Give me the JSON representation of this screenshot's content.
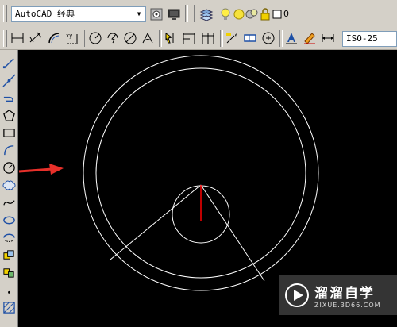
{
  "toolbar_top": {
    "workspace_combo": {
      "value": "AutoCAD 经典"
    },
    "layer_combo": {
      "value": "0"
    }
  },
  "toolbar_dim": {
    "dimstyle_combo": {
      "value": "ISO-25"
    }
  },
  "left_toolbar": {
    "items": [
      "line-icon",
      "construction-line-icon",
      "polyline-icon",
      "polygon-icon",
      "rectangle-icon",
      "arc-icon",
      "circle-icon",
      "revision-cloud-icon",
      "spline-icon",
      "ellipse-icon",
      "ellipse-arc-icon",
      "insert-block-icon",
      "make-block-icon",
      "point-icon",
      "hatch-icon"
    ]
  },
  "canvas": {
    "background": "#000000",
    "stroke": "#ffffff",
    "axis_color": "#ff0000"
  },
  "callout": {
    "color": "#e8302a"
  },
  "watermark": {
    "title": "溜溜自学",
    "subtitle": "ZIXUE.3D66.COM"
  }
}
